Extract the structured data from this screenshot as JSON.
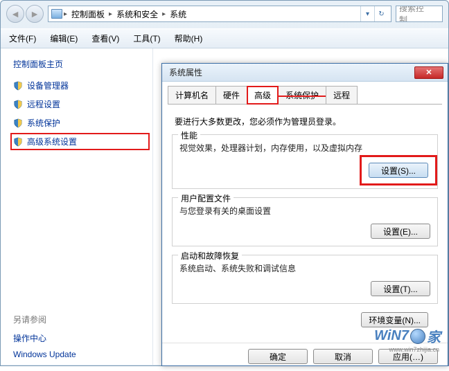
{
  "nav": {
    "crumbs": [
      "控制面板",
      "系统和安全",
      "系统"
    ]
  },
  "search": {
    "placeholder": "搜索控制…"
  },
  "menu": {
    "file": "文件(F)",
    "edit": "编辑(E)",
    "view": "查看(V)",
    "tools": "工具(T)",
    "help": "帮助(H)"
  },
  "left": {
    "home": "控制面板主页",
    "links": [
      "设备管理器",
      "远程设置",
      "系统保护",
      "高级系统设置"
    ],
    "see_also_title": "另请参阅",
    "see_also": [
      "操作中心",
      "Windows Update"
    ]
  },
  "dialog": {
    "title": "系统属性",
    "tabs": [
      "计算机名",
      "硬件",
      "高级",
      "系统保护",
      "远程"
    ],
    "admin_note": "要进行大多数更改，您必须作为管理员登录。",
    "groups": {
      "perf": {
        "label": "性能",
        "desc": "视觉效果，处理器计划，内存使用，以及虚拟内存",
        "btn": "设置(S)..."
      },
      "profile": {
        "label": "用户配置文件",
        "desc": "与您登录有关的桌面设置",
        "btn": "设置(E)..."
      },
      "startup": {
        "label": "启动和故障恢复",
        "desc": "系统启动、系统失败和调试信息",
        "btn": "设置(T)..."
      }
    },
    "env_btn": "环境变量(N)...",
    "buttons": {
      "ok": "确定",
      "cancel": "取消",
      "apply": "应用(…)"
    }
  },
  "watermark": {
    "text1": "WiN7",
    "text2": "家",
    "url": "www.win7zhijia.cn"
  }
}
